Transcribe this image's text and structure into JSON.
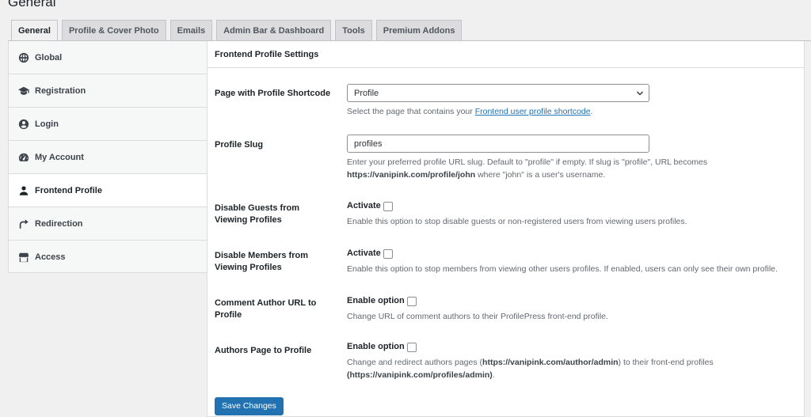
{
  "page": {
    "heading": "General"
  },
  "tabs": [
    {
      "label": "General",
      "active": true
    },
    {
      "label": "Profile & Cover Photo"
    },
    {
      "label": "Emails"
    },
    {
      "label": "Admin Bar & Dashboard"
    },
    {
      "label": "Tools"
    },
    {
      "label": "Premium Addons"
    }
  ],
  "sidebar": {
    "items": [
      {
        "label": "Global",
        "icon": "globe-icon"
      },
      {
        "label": "Registration",
        "icon": "graduation-cap-icon"
      },
      {
        "label": "Login",
        "icon": "user-circle-icon"
      },
      {
        "label": "My Account",
        "icon": "dashboard-icon"
      },
      {
        "label": "Frontend Profile",
        "icon": "user-icon",
        "active": true
      },
      {
        "label": "Redirection",
        "icon": "redirect-arrow-icon"
      },
      {
        "label": "Access",
        "icon": "store-icon"
      }
    ]
  },
  "panel": {
    "title": "Frontend Profile Settings",
    "shortcode_page": {
      "label": "Page with Profile Shortcode",
      "selected": "Profile",
      "desc_prefix": "Select the page that contains your ",
      "desc_link": "Frontend user profile shortcode",
      "desc_suffix": "."
    },
    "profile_slug": {
      "label": "Profile Slug",
      "value": "profiles",
      "desc_line1": "Enter your preferred profile URL slug. Default to \"profile\" if empty. If slug is \"profile\", URL becomes",
      "desc_url": "https://vanipink.com/profile/john",
      "desc_line2": " where \"john\" is a user's username."
    },
    "disable_guests": {
      "label": "Disable Guests from Viewing Profiles",
      "check_label": "Activate",
      "checked": false,
      "desc": "Enable this option to stop disable guests or non-registered users from viewing users profiles."
    },
    "disable_members": {
      "label": "Disable Members from Viewing Profiles",
      "check_label": "Activate",
      "checked": false,
      "desc": "Enable this option to stop members from viewing other users profiles. If enabled, users can only see their own profile."
    },
    "comment_author": {
      "label": "Comment Author URL to Profile",
      "check_label": "Enable option",
      "checked": false,
      "desc": "Change URL of comment authors to their ProfilePress front-end profile."
    },
    "authors_page": {
      "label": "Authors Page to Profile",
      "check_label": "Enable option",
      "checked": false,
      "desc_prefix": "Change and redirect authors pages (",
      "desc_url1": "https://vanipink.com/author/admin",
      "desc_mid": ") to their front-end profiles",
      "desc_url2": "(https://vanipink.com/profiles/admin)",
      "desc_suffix": "."
    },
    "save_label": "Save Changes"
  },
  "colors": {
    "accent": "#2271b1",
    "background": "#f0f0f1"
  }
}
